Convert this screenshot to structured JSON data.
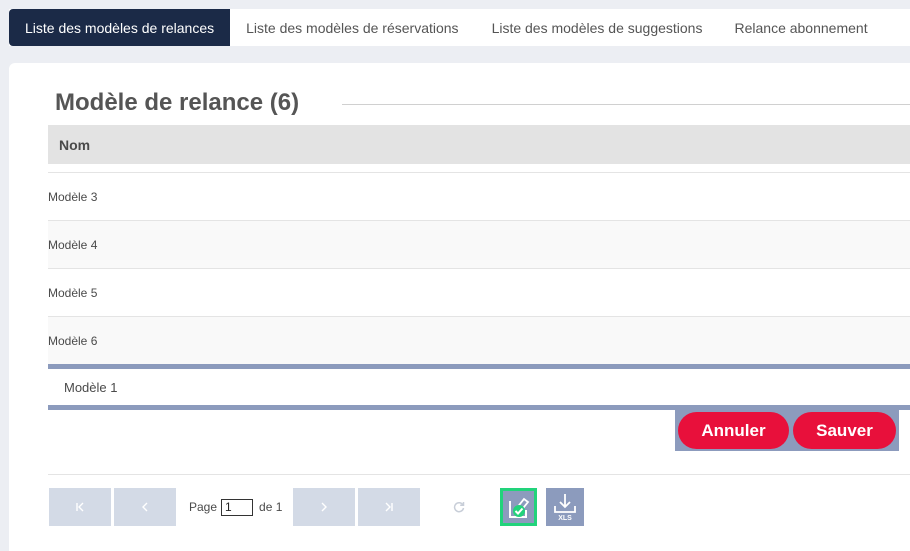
{
  "tabs": [
    {
      "label": "Liste des modèles de relances",
      "active": true
    },
    {
      "label": "Liste des modèles de réservations",
      "active": false
    },
    {
      "label": "Liste des modèles de suggestions",
      "active": false
    },
    {
      "label": "Relance abonnement",
      "active": false
    }
  ],
  "section": {
    "title": "Modèle de relance (6)"
  },
  "table": {
    "column_header": "Nom",
    "rows": [
      "Modèle 3",
      "Modèle 4",
      "Modèle 5",
      "Modèle 6"
    ]
  },
  "editor": {
    "value": "Modèle 1"
  },
  "actions": {
    "cancel_label": "Annuler",
    "save_label": "Sauver"
  },
  "pager": {
    "first_icon": "first-page-icon",
    "prev_icon": "previous-page-icon",
    "next_icon": "next-page-icon",
    "last_icon": "last-page-icon",
    "page_label": "Page",
    "current_page": "1",
    "of_label": "de 1",
    "refresh_icon": "refresh-icon",
    "confirm_icon": "edit-confirm-icon",
    "export_icon": "xls-download-icon",
    "export_text": "XLS"
  },
  "colors": {
    "active_tab": "#1b2a47",
    "accent_blue": "#8c9bbd",
    "button_red": "#e8103b",
    "confirm_green": "#22d37b"
  }
}
